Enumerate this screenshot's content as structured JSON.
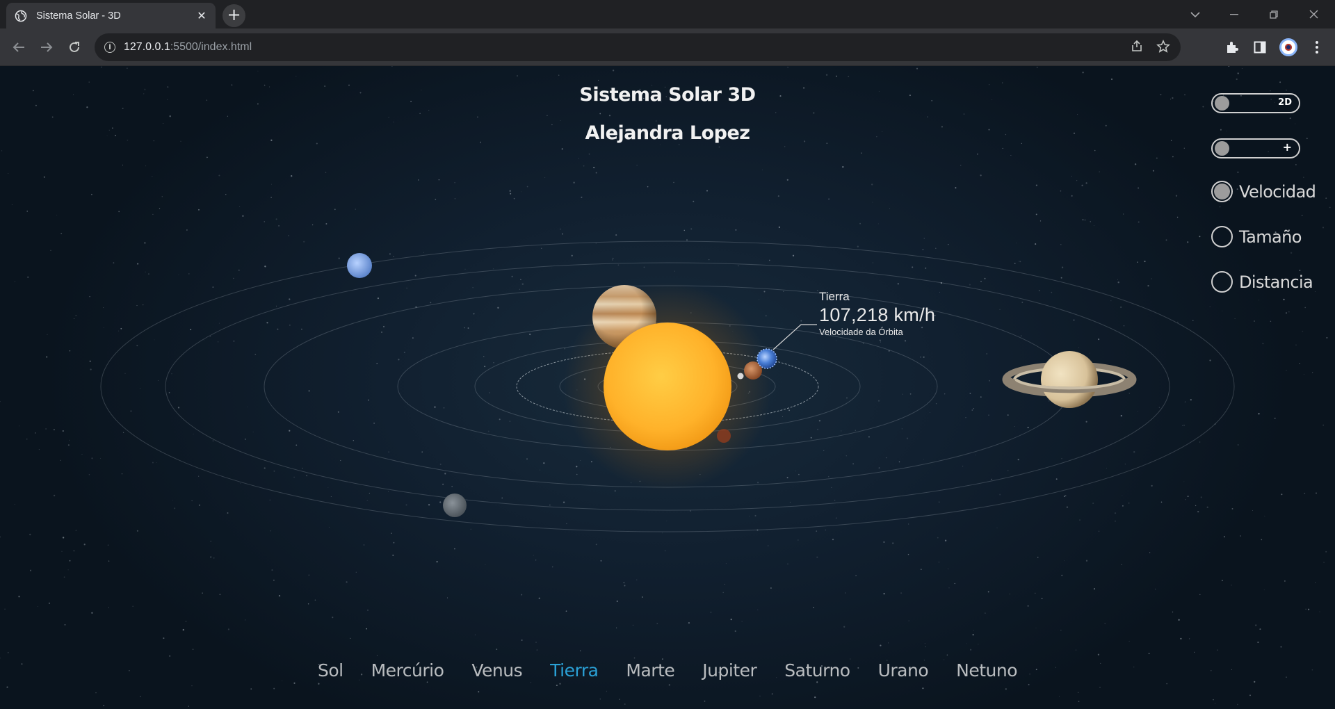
{
  "browser": {
    "tab_title": "Sistema Solar - 3D",
    "close_glyph": "✕",
    "new_tab_glyph": "+",
    "url_host": "127.0.0.1",
    "url_path": ":5500/index.html",
    "icons": [
      "back-arrow-icon",
      "forward-arrow-icon",
      "reload-icon",
      "info-icon",
      "share-icon",
      "star-icon",
      "extensions-icon",
      "sidebar-icon",
      "profile-avatar",
      "menu-icon"
    ]
  },
  "page": {
    "title": "Sistema Solar 3D",
    "author": "Alejandra Lopez"
  },
  "callout": {
    "planet": "Tierra",
    "speed": "107,218 km/h",
    "label": "Velocidade da Órbita"
  },
  "controls": {
    "toggle_view": {
      "label": "2D",
      "on": false
    },
    "toggle_plus": {
      "label": "+",
      "on": false
    },
    "options": [
      {
        "label": "Velocidad",
        "selected": true
      },
      {
        "label": "Tamaño",
        "selected": false
      },
      {
        "label": "Distancia",
        "selected": false
      }
    ]
  },
  "planet_nav": {
    "items": [
      "Sol",
      "Mercúrio",
      "Venus",
      "Tierra",
      "Marte",
      "Jupiter",
      "Saturno",
      "Urano",
      "Netuno"
    ],
    "active": "Tierra"
  },
  "colors": {
    "accent_active": "#2aa1d6",
    "sun": "#ffb733",
    "earth": "#4a7fd6",
    "mars": "#b86a3c",
    "saturn": "#d8c7a0",
    "jupiter": "#c9a57d",
    "uranus": "#8fb3e6",
    "neptune": "#6e7780"
  }
}
